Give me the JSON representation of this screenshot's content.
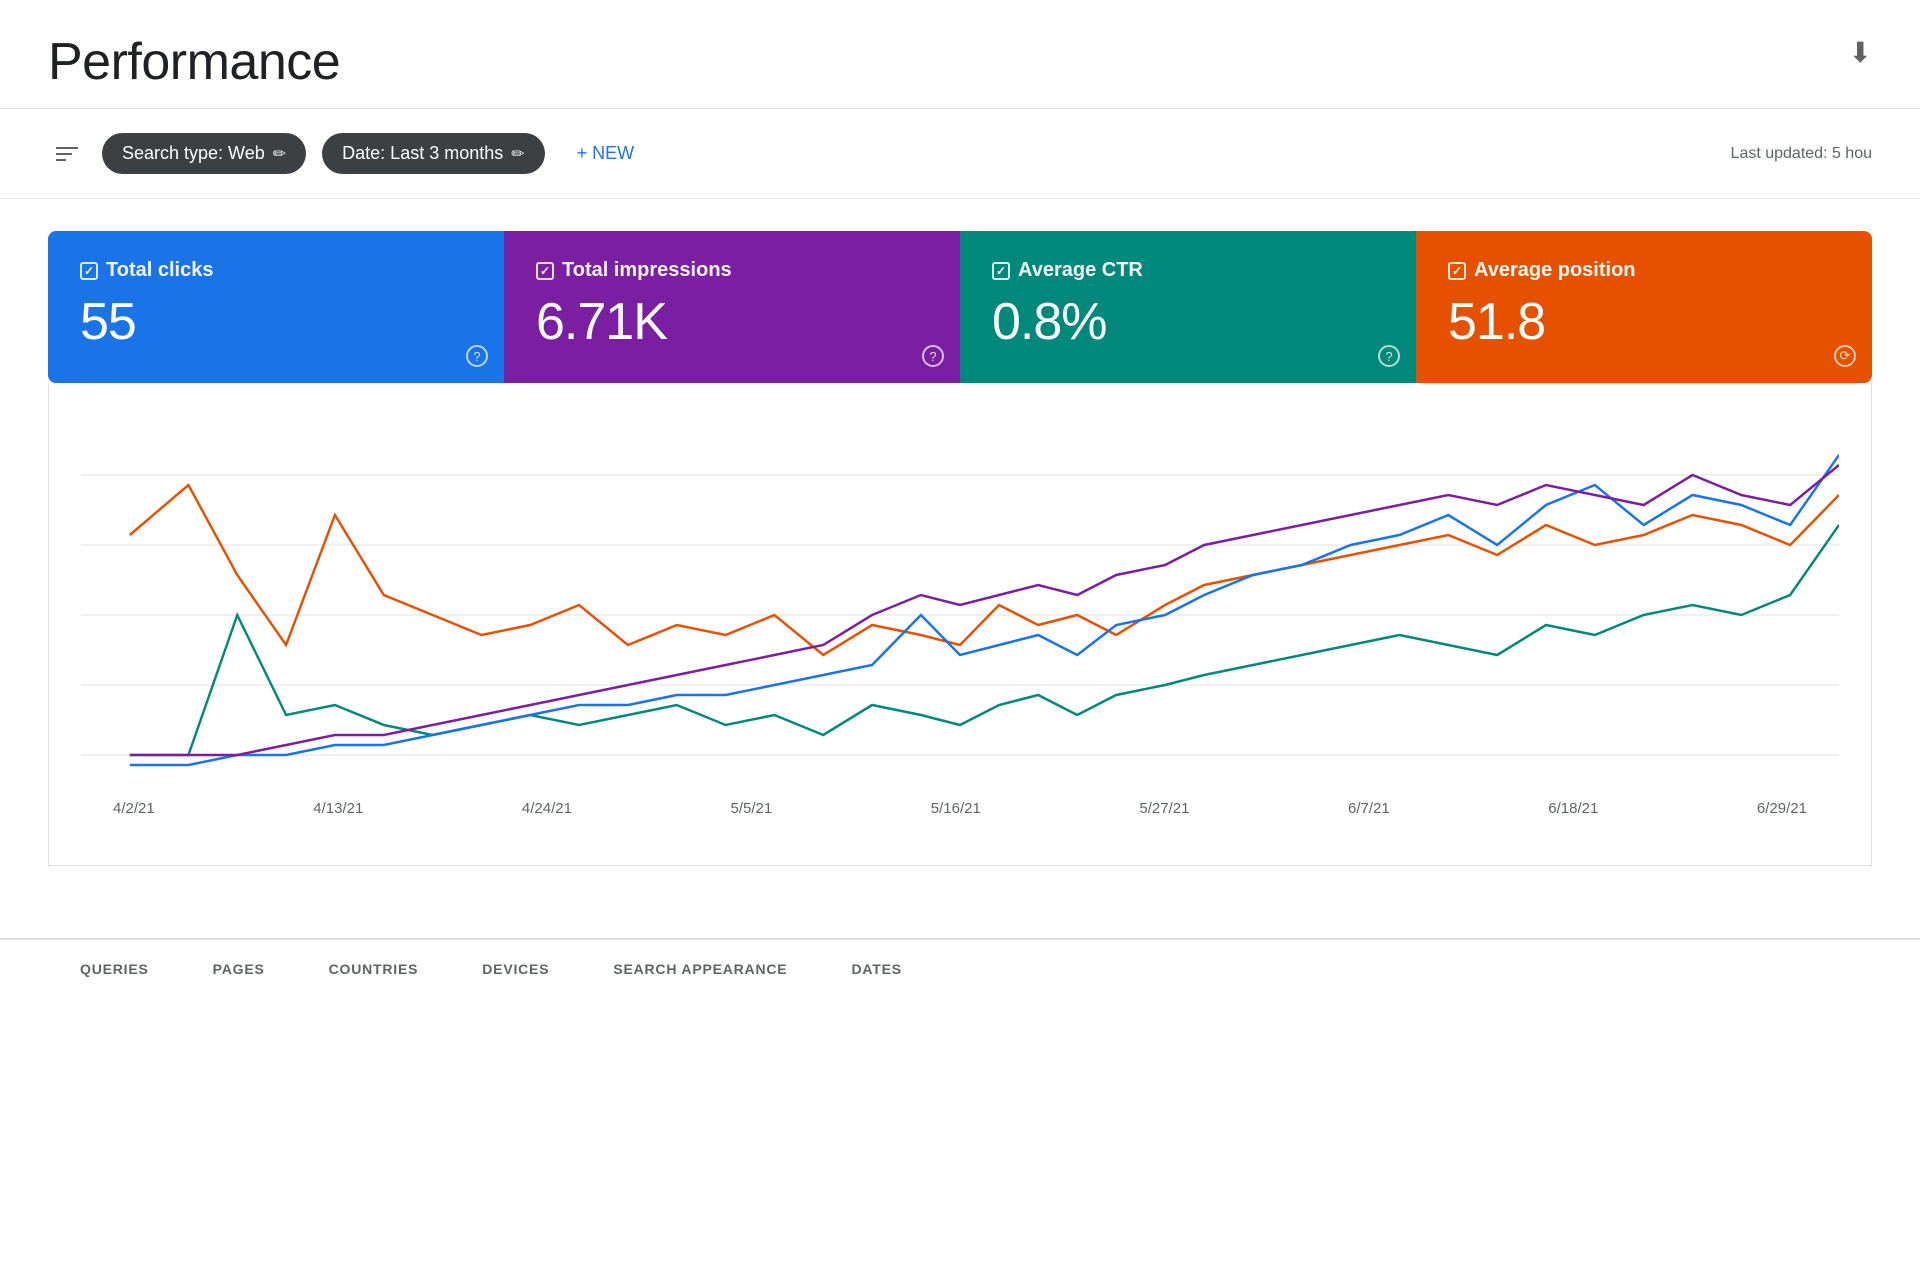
{
  "header": {
    "title": "Performance",
    "last_updated": "Last updated: 5 hou"
  },
  "filters": {
    "filter_icon_label": "Filter",
    "search_type": "Search type: Web",
    "date_range": "Date: Last 3 months",
    "new_button": "+ NEW",
    "edit_icon": "✏"
  },
  "metrics": [
    {
      "id": "clicks",
      "label": "Total clicks",
      "value": "55",
      "color": "#1a73e8",
      "checked": true
    },
    {
      "id": "impressions",
      "label": "Total impressions",
      "value": "6.71K",
      "color": "#7b1fa2",
      "checked": true
    },
    {
      "id": "ctr",
      "label": "Average CTR",
      "value": "0.8%",
      "color": "#00897b",
      "checked": true
    },
    {
      "id": "position",
      "label": "Average position",
      "value": "51.8",
      "color": "#e65100",
      "checked": true
    }
  ],
  "chart": {
    "dates": [
      "4/2/21",
      "4/13/21",
      "4/24/21",
      "5/5/21",
      "5/16/21",
      "5/27/21",
      "6/7/21",
      "6/18/21",
      "6/29/21"
    ],
    "lines": {
      "clicks": "#1a73e8",
      "impressions": "#7b1fa2",
      "ctr": "#00897b",
      "position": "#e65100"
    }
  },
  "tabs": [
    {
      "id": "queries",
      "label": "QUERIES"
    },
    {
      "id": "pages",
      "label": "PAGES"
    },
    {
      "id": "countries",
      "label": "COUNTRIES"
    },
    {
      "id": "devices",
      "label": "DEVICES"
    },
    {
      "id": "search-appearance",
      "label": "SEARCH APPEARANCE"
    },
    {
      "id": "dates",
      "label": "DATES"
    }
  ]
}
